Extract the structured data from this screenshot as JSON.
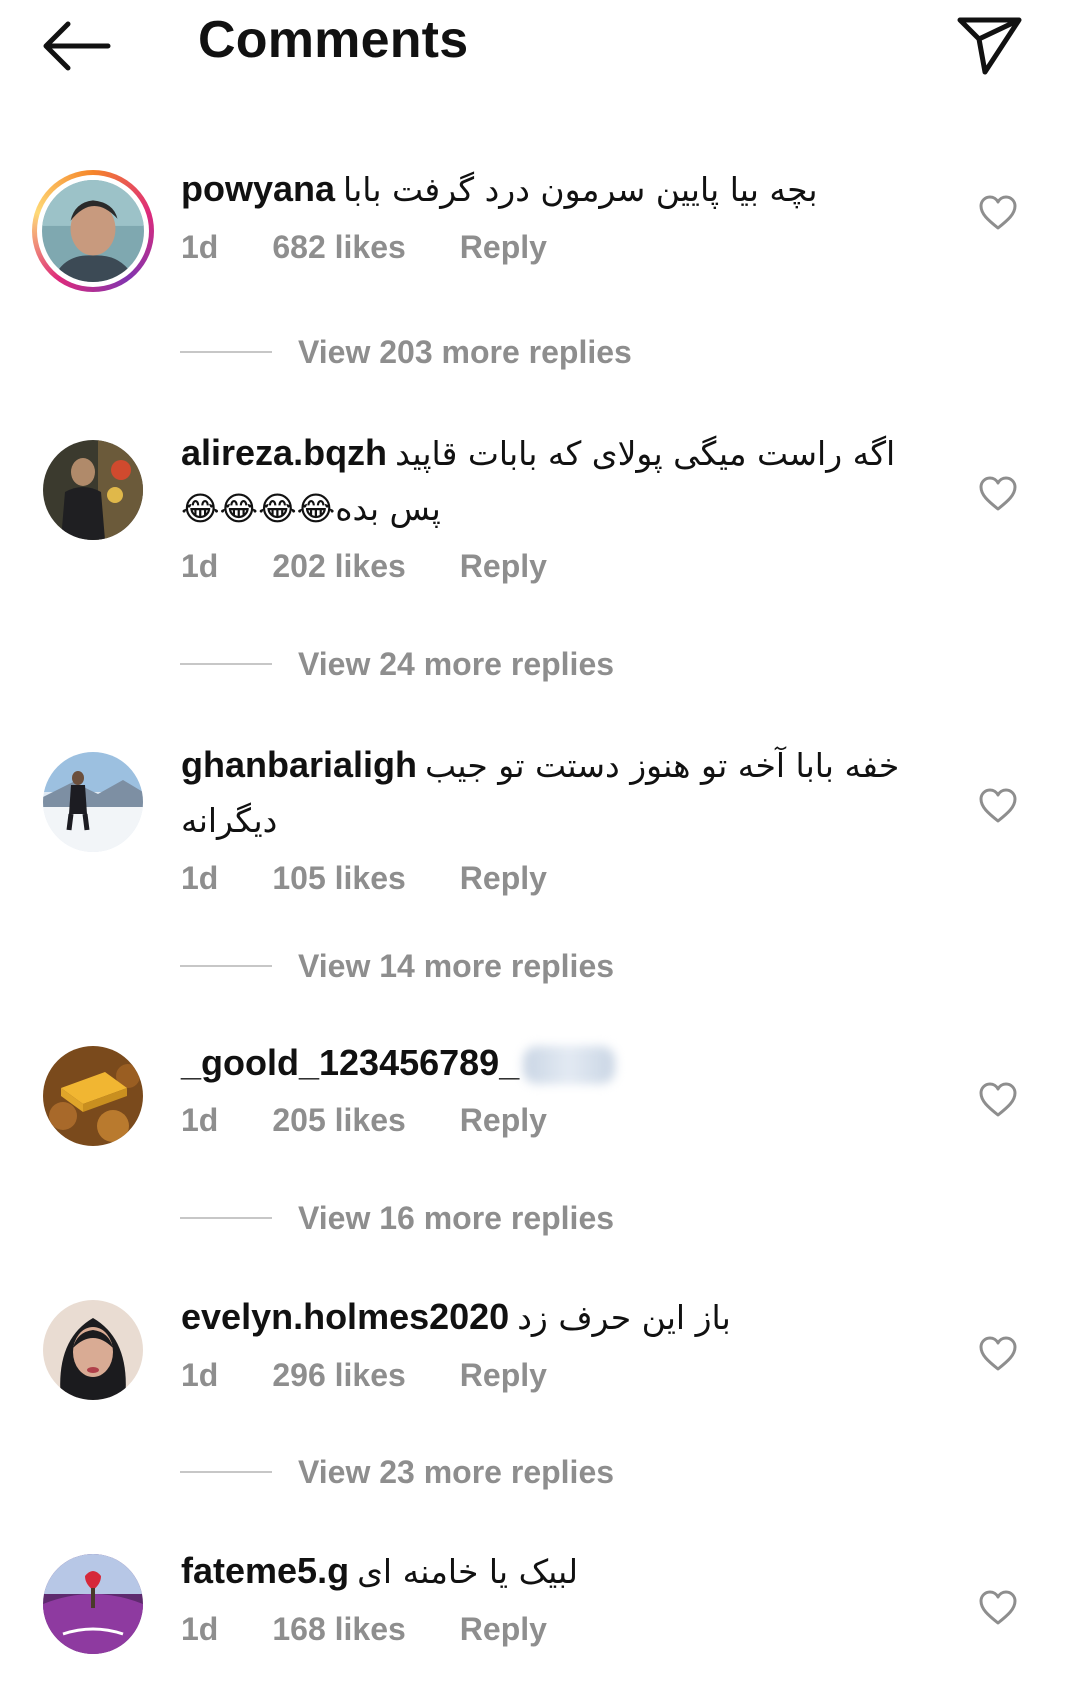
{
  "header": {
    "title": "Comments"
  },
  "comments": [
    {
      "username": "powyana",
      "text": "بچه بیا پایین سرمون درد گرفت بابا",
      "time": "1d",
      "likes": "682 likes",
      "reply": "Reply",
      "view_replies": "View 203 more replies",
      "has_story": true
    },
    {
      "username": "alireza.bqzh",
      "text": "اگه راست میگی پولای که بابات قاپید پس بده😂😂😂😂",
      "time": "1d",
      "likes": "202 likes",
      "reply": "Reply",
      "view_replies": "View 24 more replies"
    },
    {
      "username": "ghanbarialigh",
      "text": "خفه بابا  آخه تو هنوز دستت تو جیب دیگرانه",
      "time": "1d",
      "likes": "105 likes",
      "reply": "Reply",
      "view_replies": "View 14 more replies"
    },
    {
      "username": "_goold_123456789_",
      "text": "",
      "time": "1d",
      "likes": "205 likes",
      "reply": "Reply",
      "view_replies": "View 16 more replies"
    },
    {
      "username": "evelyn.holmes2020",
      "text": "باز این حرف زد",
      "time": "1d",
      "likes": "296 likes",
      "reply": "Reply",
      "view_replies": "View 23 more replies"
    },
    {
      "username": "fateme5.g",
      "text": "لبیک یا خامنه ای",
      "time": "1d",
      "likes": "168 likes",
      "reply": "Reply"
    }
  ],
  "colors": {
    "meta_gray": "#8e8e8e",
    "divider": "#c7c7c7",
    "text": "#111111"
  },
  "icons": {
    "back": "arrow-left-icon",
    "share": "paper-plane-icon",
    "like": "heart-outline-icon"
  }
}
